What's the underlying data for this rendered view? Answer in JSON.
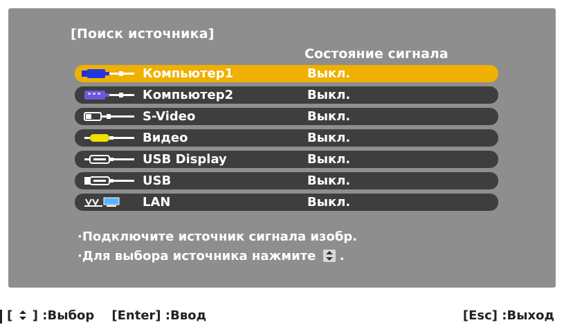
{
  "dialog": {
    "title": "[Поиск источника]",
    "column_header": "Состояние сигнала"
  },
  "sources": [
    {
      "label": "Компьютер1",
      "status": "Выкл.",
      "icon": "computer1-icon",
      "selected": true
    },
    {
      "label": "Компьютер2",
      "status": "Выкл.",
      "icon": "computer2-icon",
      "selected": false
    },
    {
      "label": "S-Video",
      "status": "Выкл.",
      "icon": "svideo-icon",
      "selected": false
    },
    {
      "label": "Видео",
      "status": "Выкл.",
      "icon": "video-icon",
      "selected": false
    },
    {
      "label": "USB Display",
      "status": "Выкл.",
      "icon": "usb-display-icon",
      "selected": false
    },
    {
      "label": "USB",
      "status": "Выкл.",
      "icon": "usb-icon",
      "selected": false
    },
    {
      "label": "LAN",
      "status": "Выкл.",
      "icon": "lan-icon",
      "selected": false
    }
  ],
  "messages": {
    "line1": "·Подключите источник сигнала изобр.",
    "line2": "·Для выбора источника нажмите",
    "line2_end": "."
  },
  "footer": {
    "select_key_open": "[",
    "select_key_close": "] :Выбор",
    "enter": "[Enter] :Ввод",
    "esc": "[Esc] :Выход"
  },
  "colors": {
    "panel": "#8e8e8e",
    "row": "#3e3e3e",
    "selected_row": "#efb000"
  }
}
